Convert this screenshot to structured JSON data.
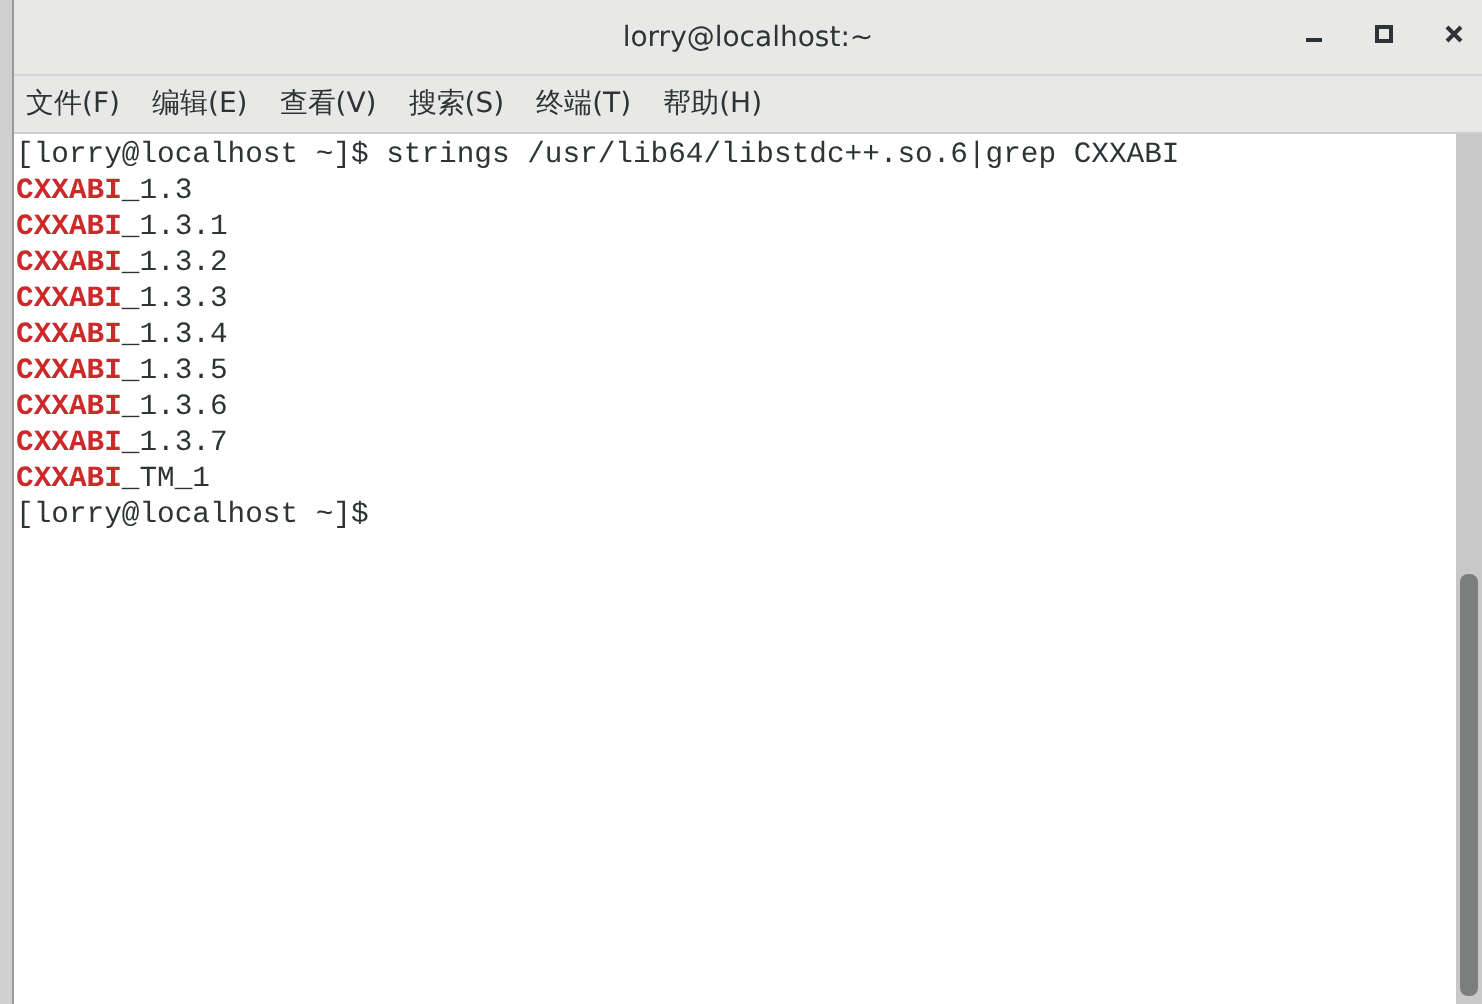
{
  "window": {
    "title": "lorry@localhost:~"
  },
  "menu": [
    {
      "label": "文件(F)"
    },
    {
      "label": "编辑(E)"
    },
    {
      "label": "查看(V)"
    },
    {
      "label": "搜索(S)"
    },
    {
      "label": "终端(T)"
    },
    {
      "label": "帮助(H)"
    }
  ],
  "terminal": {
    "lines": [
      {
        "kind": "prompt",
        "text": "[lorry@localhost ~]$ strings /usr/lib64/libstdc++.so.6|grep CXXABI"
      },
      {
        "kind": "match",
        "match": "CXXABI",
        "rest": "_1.3"
      },
      {
        "kind": "match",
        "match": "CXXABI",
        "rest": "_1.3.1"
      },
      {
        "kind": "match",
        "match": "CXXABI",
        "rest": "_1.3.2"
      },
      {
        "kind": "match",
        "match": "CXXABI",
        "rest": "_1.3.3"
      },
      {
        "kind": "match",
        "match": "CXXABI",
        "rest": "_1.3.4"
      },
      {
        "kind": "match",
        "match": "CXXABI",
        "rest": "_1.3.5"
      },
      {
        "kind": "match",
        "match": "CXXABI",
        "rest": "_1.3.6"
      },
      {
        "kind": "match",
        "match": "CXXABI",
        "rest": "_1.3.7"
      },
      {
        "kind": "match",
        "match": "CXXABI",
        "rest": "_TM_1"
      },
      {
        "kind": "prompt",
        "text": "[lorry@localhost ~]$"
      }
    ]
  }
}
